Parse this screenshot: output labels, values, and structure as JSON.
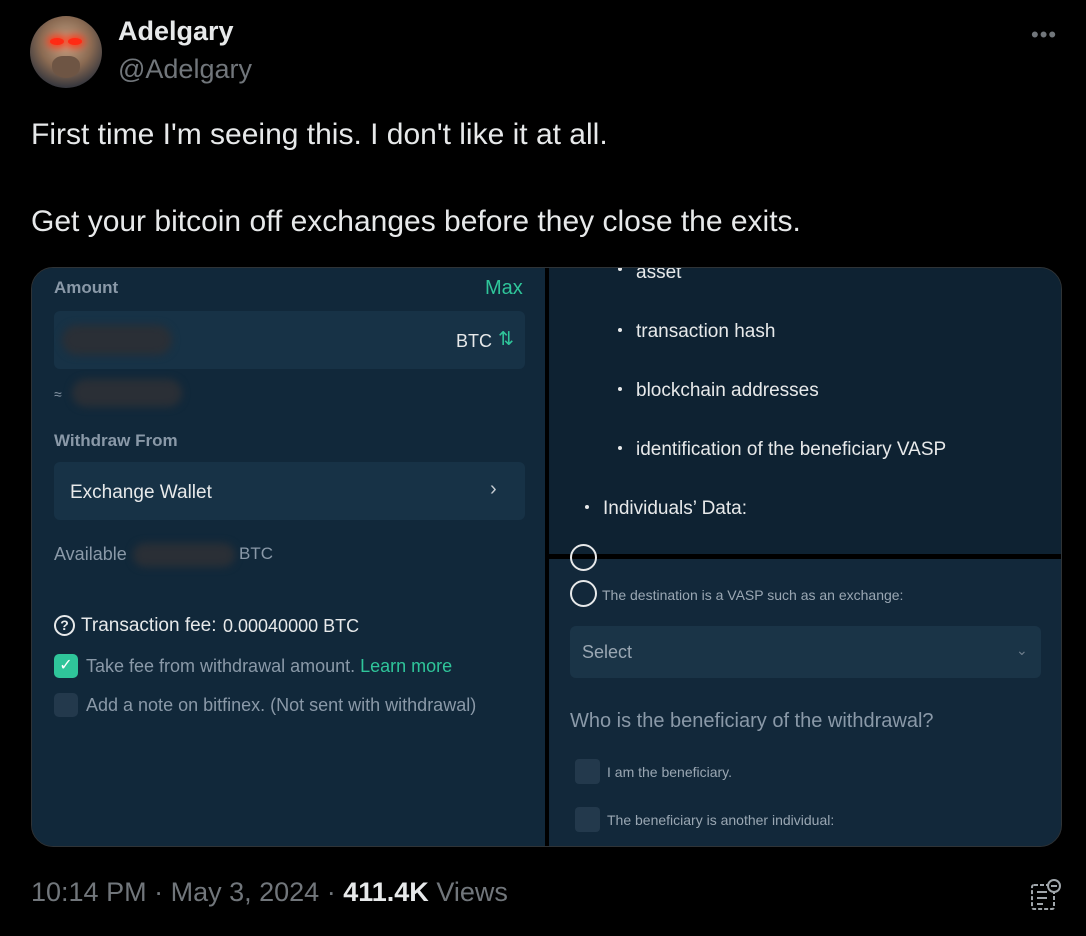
{
  "author": {
    "display_name": "Adelgary",
    "handle": "@Adelgary"
  },
  "menu_icon": "more-horizontal-icon",
  "tweet_text": {
    "line1": "First time I'm seeing this. I don't like it at all.",
    "line2": "Get your bitcoin off exchanges before they close the exits."
  },
  "screenshot": {
    "left_panel": {
      "amount_label": "Amount",
      "max_label": "Max",
      "currency": "BTC",
      "swap_icon": "swap-arrows-icon",
      "approx_symbol": "≈",
      "withdraw_from_label": "Withdraw From",
      "withdraw_from_value": "Exchange Wallet",
      "chevron": "›",
      "available_label": "Available",
      "available_currency": "BTC",
      "fee_icon": "?",
      "fee_label": "Transaction fee:",
      "fee_value": "0.00040000 BTC",
      "take_fee_checked": true,
      "take_fee_label": "Take fee from withdrawal amount.",
      "learn_more": "Learn more",
      "add_note_checked": false,
      "add_note_label": "Add a note on bitfinex. (Not sent with withdrawal)"
    },
    "right_top": {
      "sub_bullets": [
        "asset",
        "transaction hash",
        "blockchain addresses",
        "identification of the beneficiary VASP"
      ],
      "main_bullet": "Individuals’ Data:"
    },
    "right_bottom": {
      "vasp_option": "The destination is a VASP such as an exchange:",
      "select_placeholder": "Select",
      "select_chevron": "⌄",
      "beneficiary_question": "Who is the beneficiary of the withdrawal?",
      "options": [
        "I am the beneficiary.",
        "The beneficiary is another individual:"
      ]
    }
  },
  "footer": {
    "time": "10:14 PM",
    "date": "May 3, 2024",
    "separator": "·",
    "views_count": "411.4K",
    "views_label": "Views",
    "analytics_icon": "analytics-icon"
  },
  "colors": {
    "accent_green": "#2fc59a",
    "muted_text": "#71767b",
    "panel_bg": "#11283a"
  }
}
